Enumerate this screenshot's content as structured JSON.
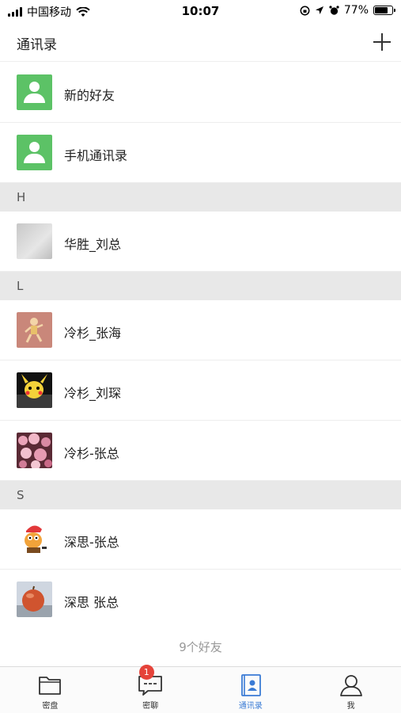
{
  "status_bar": {
    "carrier": "中国移动",
    "time": "10:07",
    "battery": "77%",
    "battery_level": 0.77
  },
  "header": {
    "title": "通讯录",
    "add_icon": "plus-icon"
  },
  "fixed_entries": [
    {
      "label": "新的好友",
      "icon": "person-icon"
    },
    {
      "label": "手机通讯录",
      "icon": "person-icon"
    }
  ],
  "sections": [
    {
      "letter": "H",
      "contacts": [
        {
          "name": "华胜_刘总"
        }
      ]
    },
    {
      "letter": "L",
      "contacts": [
        {
          "name": "冷杉_张海"
        },
        {
          "name": "冷杉_刘琛"
        },
        {
          "name": "冷杉-张总"
        }
      ]
    },
    {
      "letter": "S",
      "contacts": [
        {
          "name": "深思-张总"
        },
        {
          "name": "深思 张总"
        }
      ]
    }
  ],
  "friend_count": "9个好友",
  "tabbar": {
    "tabs": [
      {
        "label": "密盘",
        "icon": "folder-icon"
      },
      {
        "label": "密聊",
        "icon": "chat-icon",
        "badge": "1"
      },
      {
        "label": "通讯录",
        "icon": "contacts-icon",
        "active": true
      },
      {
        "label": "我",
        "icon": "profile-icon"
      }
    ]
  },
  "colors": {
    "accent": "#3a7bd5",
    "avatar_green": "#5cc266",
    "badge_red": "#e5433a",
    "section_bg": "#e8e8e8"
  }
}
